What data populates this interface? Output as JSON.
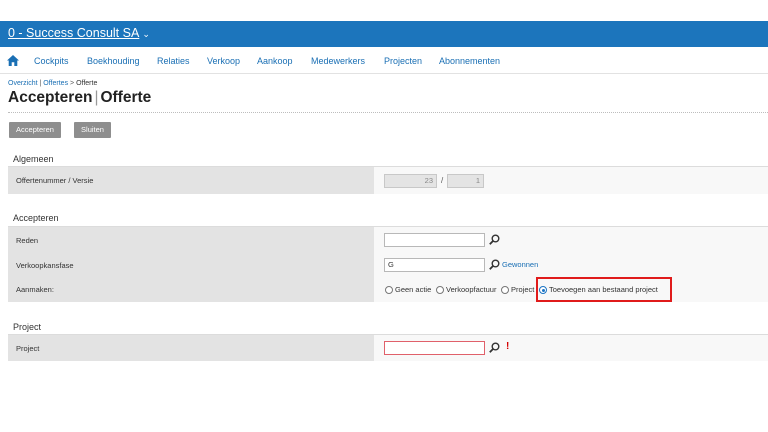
{
  "header": {
    "company": "0 - Success Consult SA",
    "caret": "⌄"
  },
  "nav": {
    "home_icon": "home-icon",
    "items": [
      "Cockpits",
      "Boekhouding",
      "Relaties",
      "Verkoop",
      "Aankoop",
      "Medewerkers",
      "Projecten",
      "Abonnementen"
    ]
  },
  "breadcrumb": {
    "items": [
      "Overzicht",
      "Offertes",
      "Offerte"
    ],
    "separators": [
      "|",
      ">"
    ]
  },
  "page": {
    "title_main": "Accepteren",
    "title_sep": "|",
    "title_sub": "Offerte"
  },
  "toolbar": {
    "accept_label": "Accepteren",
    "close_label": "Sluiten"
  },
  "sections": {
    "algemeen": {
      "heading": "Algemeen",
      "offer_label": "Offertenummer / Versie",
      "offer_number": "23",
      "slash": "/",
      "version": "1"
    },
    "accepteren": {
      "heading": "Accepteren",
      "reason_label": "Reden",
      "reason_value": "",
      "phase_label": "Verkoopkansfase",
      "phase_value": "G",
      "phase_link": "Gewonnen",
      "create_label": "Aanmaken:",
      "create_options": [
        {
          "label": "Geen actie",
          "selected": false
        },
        {
          "label": "Verkoopfactuur",
          "selected": false
        },
        {
          "label": "Project",
          "selected": false
        },
        {
          "label": "Toevoegen aan bestaand project",
          "selected": true
        }
      ]
    },
    "project": {
      "heading": "Project",
      "project_label": "Project",
      "project_value": "",
      "required_mark": "!"
    }
  },
  "colors": {
    "topbar": "#1c75bc",
    "link": "#1a6fb4",
    "button": "#8e8e8e",
    "highlight": "#e01b1b",
    "error": "#d40000"
  }
}
